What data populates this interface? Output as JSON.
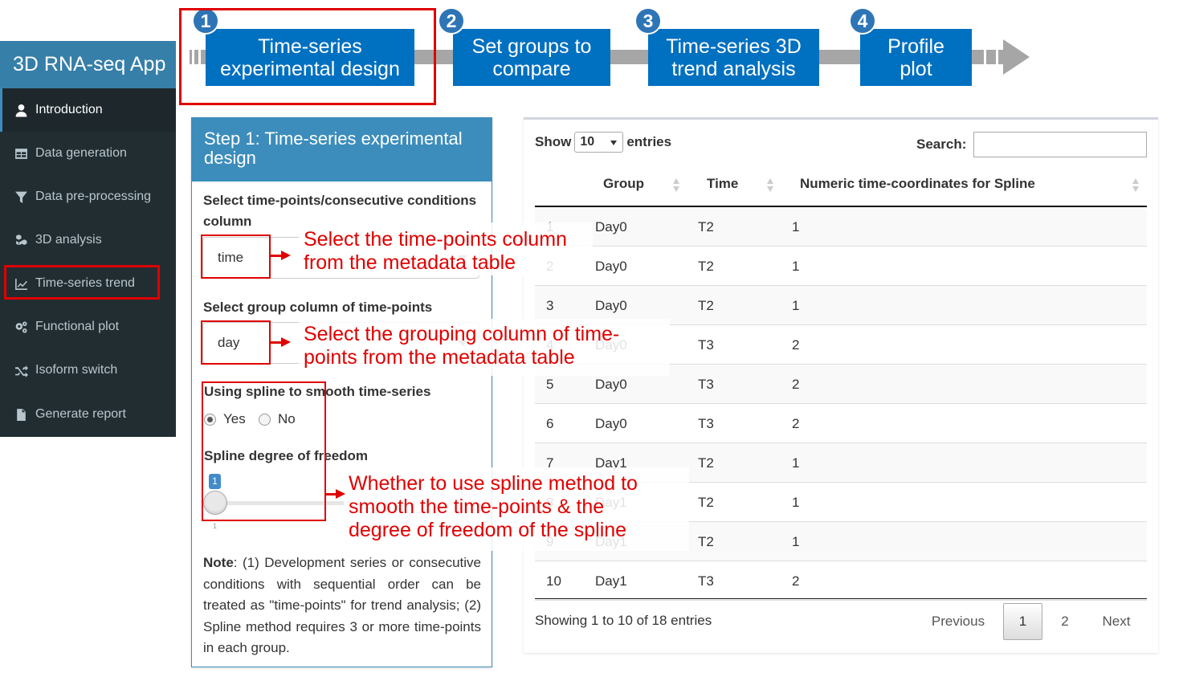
{
  "app": {
    "title": "3D RNA-seq App"
  },
  "sidebar": {
    "items": [
      {
        "label": "Introduction",
        "icon": "user-icon"
      },
      {
        "label": "Data generation",
        "icon": "table-icon"
      },
      {
        "label": "Data pre-processing",
        "icon": "filter-icon"
      },
      {
        "label": "3D analysis",
        "icon": "cubes-icon"
      },
      {
        "label": "Time-series trend",
        "icon": "line-chart-icon"
      },
      {
        "label": "Functional plot",
        "icon": "gears-icon"
      },
      {
        "label": "Isoform switch",
        "icon": "random-icon"
      },
      {
        "label": "Generate report",
        "icon": "file-icon"
      }
    ]
  },
  "steps": [
    {
      "num": "1",
      "label_line1": "Time-series",
      "label_line2": "experimental design"
    },
    {
      "num": "2",
      "label_line1": "Set groups to",
      "label_line2": "compare"
    },
    {
      "num": "3",
      "label_line1": "Time-series 3D",
      "label_line2": "trend analysis"
    },
    {
      "num": "4",
      "label_line1": "Profile",
      "label_line2": "plot"
    }
  ],
  "panel": {
    "title": "Step 1: Time-series experimental design",
    "timepoint_label": "Select time-points/consecutive conditions column",
    "timepoint_value": "time",
    "group_label": "Select group column of time-points",
    "group_value": "day",
    "spline_label": "Using spline to smooth time-series",
    "spline_yes": "Yes",
    "spline_no": "No",
    "spline_selected": "Yes",
    "df_label": "Spline degree of freedom",
    "df_value": "1",
    "df_min": "1",
    "note_bold": "Note",
    "note_text": ": (1) Development series or consecutive conditions with sequential order can be treated as \"time-points\" for trend analysis; (2) Spline method requires 3 or more time-points in each group."
  },
  "table": {
    "show_label": "Show",
    "entries_value": "10",
    "entries_label": "entries",
    "search_label": "Search:",
    "columns": [
      "Group",
      "Time",
      "Numeric time-coordinates for Spline"
    ],
    "rows": [
      [
        "1",
        "Day0",
        "T2",
        "1"
      ],
      [
        "2",
        "Day0",
        "T2",
        "1"
      ],
      [
        "3",
        "Day0",
        "T2",
        "1"
      ],
      [
        "4",
        "Day0",
        "T3",
        "2"
      ],
      [
        "5",
        "Day0",
        "T3",
        "2"
      ],
      [
        "6",
        "Day0",
        "T3",
        "2"
      ],
      [
        "7",
        "Day1",
        "T2",
        "1"
      ],
      [
        "8",
        "Day1",
        "T2",
        "1"
      ],
      [
        "9",
        "Day1",
        "T2",
        "1"
      ],
      [
        "10",
        "Day1",
        "T3",
        "2"
      ]
    ],
    "info": "Showing 1 to 10 of 18 entries",
    "prev": "Previous",
    "page1": "1",
    "page2": "2",
    "next": "Next"
  },
  "annotations": {
    "a1_line1": "Select the time-points column",
    "a1_line2": "from the metadata table",
    "a2_line1": "Select the grouping column of time-",
    "a2_line2": "points from the metadata table",
    "a3_line1": "Whether to use spline method to",
    "a3_line2": "smooth the time-points & the",
    "a3_line3": "degree of freedom of the spline",
    "color": "#e00000"
  },
  "colors": {
    "sidebar_bg": "#222d32",
    "header_blue": "#367fa9",
    "step_blue": "#0070c0",
    "panel_blue": "#3c8dbc"
  }
}
